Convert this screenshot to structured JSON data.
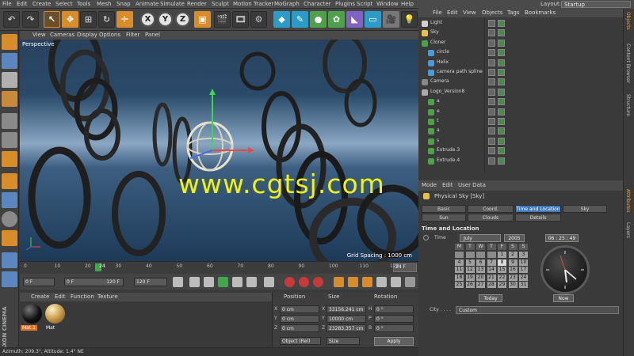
{
  "menubar": {
    "items": [
      "File",
      "Edit",
      "Create",
      "Select",
      "Tools",
      "Mesh",
      "Snap",
      "Animate",
      "Simulate",
      "Render",
      "Sculpt",
      "Motion Tracker",
      "MoGraph",
      "Character",
      "Plugins",
      "Script",
      "Window",
      "Help"
    ],
    "layout_label": "Layout:",
    "layout_value": "Startup"
  },
  "toolbar": {
    "x_label": "X",
    "y_label": "Y",
    "z_label": "Z"
  },
  "viewport": {
    "menu": [
      "View",
      "Cameras",
      "Display",
      "Options",
      "Filter",
      "Panel"
    ],
    "label": "Perspective",
    "grid_spacing": "Grid Spacing : 1000 cm",
    "watermark": "www.cgtsj.com"
  },
  "timeline": {
    "ticks": [
      "0",
      "10",
      "20",
      "30",
      "40",
      "50",
      "60",
      "70",
      "80",
      "90",
      "100",
      "110",
      "120"
    ],
    "current_frame": "24",
    "end_frame": "24 F"
  },
  "transport": {
    "start": "0 F",
    "preview_start": "0 F",
    "preview_end": "120 F",
    "end": "120 F"
  },
  "materials": {
    "menu": [
      "Create",
      "Edit",
      "Function",
      "Texture"
    ],
    "items": [
      {
        "label": "Mat.1",
        "color": "#111111"
      },
      {
        "label": "Mat",
        "color": "#c89b4a"
      }
    ]
  },
  "coords": {
    "headers": [
      "Position",
      "Size",
      "Rotation"
    ],
    "rows": [
      {
        "axis": "X",
        "pos": "0 cm",
        "size_axis": "X",
        "size": "33156.241 cm",
        "rot_axis": "H",
        "rot": "0 °"
      },
      {
        "axis": "Y",
        "pos": "0 cm",
        "size_axis": "Y",
        "size": "10000 cm",
        "rot_axis": "P",
        "rot": "0 °"
      },
      {
        "axis": "Z",
        "pos": "0 cm",
        "size_axis": "Z",
        "size": "23283.357 cm",
        "rot_axis": "B",
        "rot": "0 °"
      }
    ],
    "mode": "Object (Rel)",
    "size_mode": "Size",
    "apply": "Apply"
  },
  "status": {
    "text": "Azimuth: 209.3°, Altitude: 1.4° NE",
    "brand": "MAXON CINEMA 4D"
  },
  "object_manager": {
    "menu": [
      "File",
      "Edit",
      "View",
      "Objects",
      "Tags",
      "Bookmarks"
    ],
    "objects": [
      {
        "name": "Light",
        "indent": 0,
        "color": "#d0d0d0"
      },
      {
        "name": "Sky",
        "indent": 0,
        "color": "#e8c04a"
      },
      {
        "name": "Cloner",
        "indent": 0,
        "color": "#4fa04a"
      },
      {
        "name": "circle",
        "indent": 1,
        "color": "#4a9ad8"
      },
      {
        "name": "Helix",
        "indent": 1,
        "color": "#4a9ad8"
      },
      {
        "name": "camera path spline",
        "indent": 1,
        "color": "#4a9ad8"
      },
      {
        "name": "Camera",
        "indent": 0,
        "color": "#888888"
      },
      {
        "name": "Logo_Version8",
        "indent": 0,
        "color": "#aaaaaa"
      },
      {
        "name": "a",
        "indent": 1,
        "color": "#4fa04a"
      },
      {
        "name": "e",
        "indent": 1,
        "color": "#4fa04a"
      },
      {
        "name": "t",
        "indent": 1,
        "color": "#4fa04a"
      },
      {
        "name": "a",
        "indent": 1,
        "color": "#4fa04a"
      },
      {
        "name": "s",
        "indent": 1,
        "color": "#4fa04a"
      },
      {
        "name": "Extrude.3",
        "indent": 1,
        "color": "#4fa04a"
      },
      {
        "name": "Extrude.4",
        "indent": 1,
        "color": "#4fa04a"
      }
    ]
  },
  "side_tabs": [
    "Objects",
    "Content Browser",
    "Structure",
    "Attributes",
    "Layers"
  ],
  "attributes": {
    "header": [
      "Mode",
      "Edit",
      "User Data"
    ],
    "title": "Physical Sky [Sky]",
    "tabs": [
      {
        "label": "Basic",
        "active": false
      },
      {
        "label": "Coord.",
        "active": false
      },
      {
        "label": "Time and Location",
        "active": true
      },
      {
        "label": "Sky",
        "active": false
      },
      {
        "label": "Sun",
        "active": false
      },
      {
        "label": "Clouds",
        "active": false
      },
      {
        "label": "Details",
        "active": false
      }
    ],
    "section": "Time and Location",
    "time_label": "Time",
    "month": "July",
    "year": "2005",
    "clock_time": "06 : 25 : 49",
    "weekdays": [
      "M",
      "T",
      "W",
      "T",
      "F",
      "S",
      "S"
    ],
    "days": [
      "",
      "",
      "",
      "",
      "1",
      "2",
      "3",
      "4",
      "5",
      "6",
      "7",
      "8",
      "9",
      "10",
      "11",
      "12",
      "13",
      "14",
      "15",
      "16",
      "17",
      "18",
      "19",
      "20",
      "21",
      "22",
      "23",
      "24",
      "25",
      "26",
      "27",
      "28",
      "29",
      "30",
      "31"
    ],
    "selected_day": "8",
    "today_label": "Today",
    "now_label": "Now",
    "city_label": "City . . . .",
    "city_value": "Custom"
  }
}
